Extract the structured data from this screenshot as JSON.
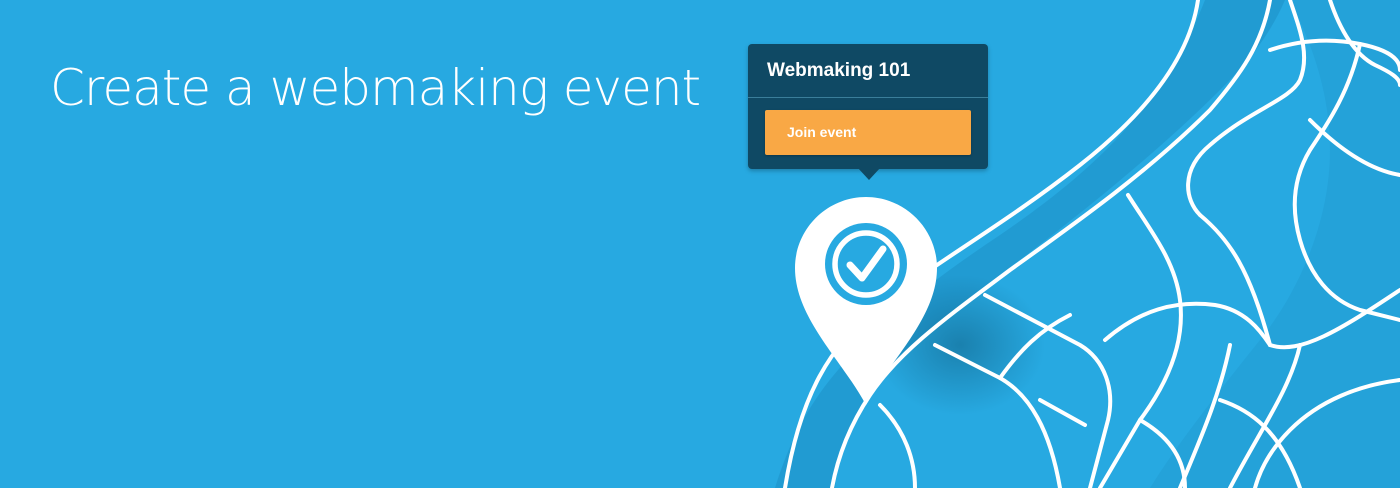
{
  "banner": {
    "headline": "Create a webmaking event",
    "background_color": "#27a9e1",
    "map_road_color": "#ffffff"
  },
  "event_popup": {
    "title": "Webmaking 101",
    "join_button_label": "Join event",
    "background_color": "#0f4964",
    "button_color": "#f9a845"
  },
  "location_pin": {
    "icon": "check-circle-icon",
    "color": "#ffffff"
  }
}
